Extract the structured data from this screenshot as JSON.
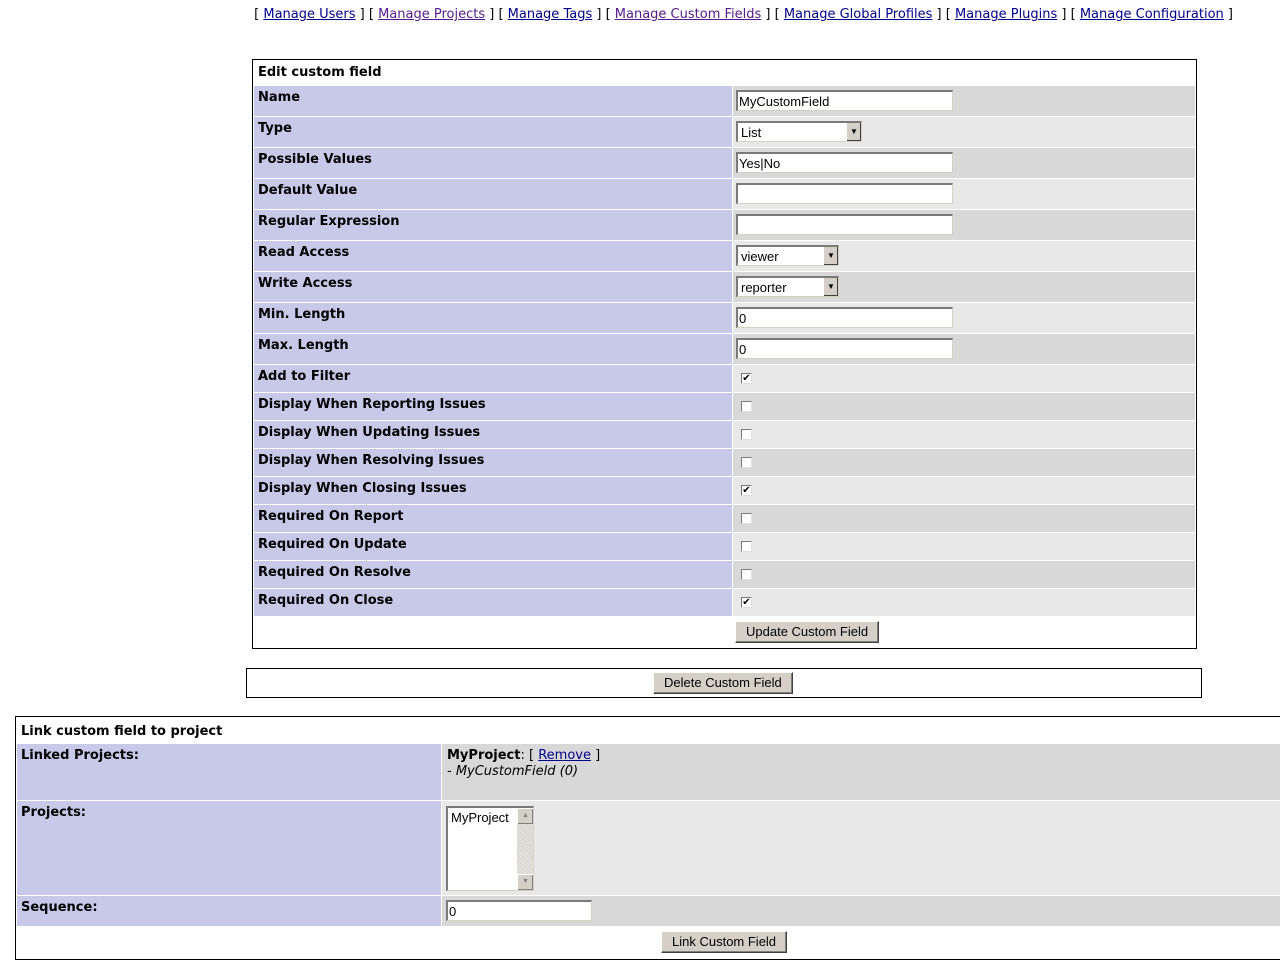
{
  "menu": {
    "items": [
      {
        "label": "Manage Users",
        "visited": false
      },
      {
        "label": "Manage Projects",
        "visited": true
      },
      {
        "label": "Manage Tags",
        "visited": false
      },
      {
        "label": "Manage Custom Fields",
        "visited": true
      },
      {
        "label": "Manage Global Profiles",
        "visited": false
      },
      {
        "label": "Manage Plugins",
        "visited": false
      },
      {
        "label": "Manage Configuration",
        "visited": false
      }
    ]
  },
  "edit_form": {
    "title": "Edit custom field",
    "name": {
      "label": "Name",
      "value": "MyCustomField"
    },
    "type": {
      "label": "Type",
      "value": "List"
    },
    "possible_values": {
      "label": "Possible Values",
      "value": "Yes|No"
    },
    "default_value": {
      "label": "Default Value",
      "value": ""
    },
    "regular_expression": {
      "label": "Regular Expression",
      "value": ""
    },
    "read_access": {
      "label": "Read Access",
      "value": "viewer"
    },
    "write_access": {
      "label": "Write Access",
      "value": "reporter"
    },
    "min_length": {
      "label": "Min. Length",
      "value": "0"
    },
    "max_length": {
      "label": "Max. Length",
      "value": "0"
    },
    "checkboxes": [
      {
        "label": "Add to Filter",
        "checked": true
      },
      {
        "label": "Display When Reporting Issues",
        "checked": false
      },
      {
        "label": "Display When Updating Issues",
        "checked": false
      },
      {
        "label": "Display When Resolving Issues",
        "checked": false
      },
      {
        "label": "Display When Closing Issues",
        "checked": true
      },
      {
        "label": "Required On Report",
        "checked": false
      },
      {
        "label": "Required On Update",
        "checked": false
      },
      {
        "label": "Required On Resolve",
        "checked": false
      },
      {
        "label": "Required On Close",
        "checked": true
      }
    ],
    "update_button": "Update Custom Field"
  },
  "delete_form": {
    "delete_button": "Delete Custom Field"
  },
  "link_form": {
    "title": "Link custom field to project",
    "linked_projects": {
      "label": "Linked Projects:",
      "project_name": "MyProject",
      "colon": ":",
      "remove_label": "Remove",
      "field_line": "- MyCustomField (0)"
    },
    "projects": {
      "label": "Projects:",
      "options": [
        "MyProject"
      ]
    },
    "sequence": {
      "label": "Sequence:",
      "value": "0"
    },
    "link_button": "Link Custom Field"
  }
}
